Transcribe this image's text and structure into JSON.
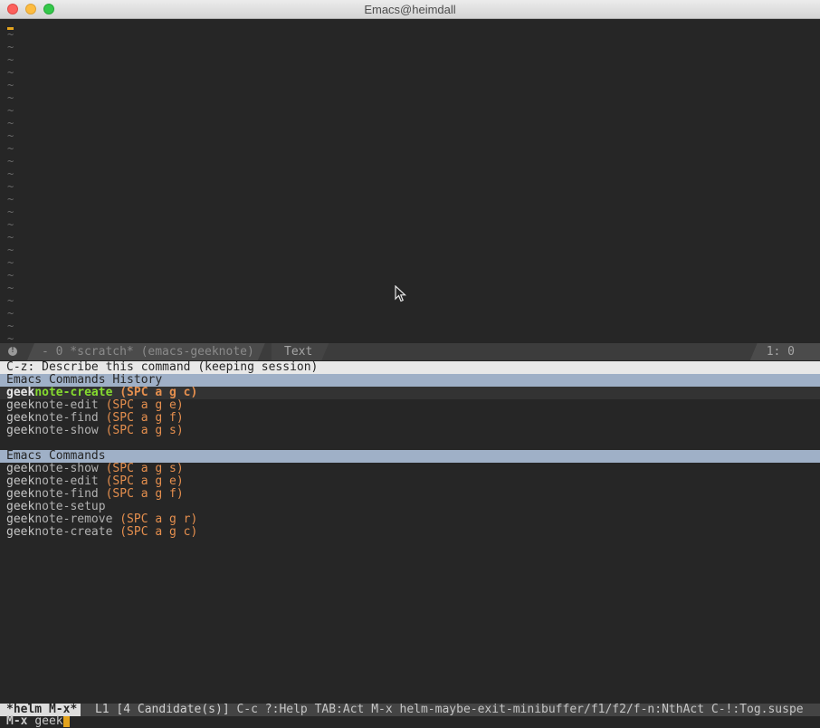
{
  "window": {
    "title": "Emacs@heimdall"
  },
  "buffer": {
    "empty_line_marker": "~",
    "empty_line_count": 25
  },
  "modeline": {
    "info_glyph": "!",
    "buffer_segment": "- 0 *scratch* (emacs-geeknote)",
    "major_mode": "Text",
    "position": "1: 0"
  },
  "helm": {
    "help_line": "C-z: Describe this command (keeping session)",
    "sources": [
      {
        "header": "Emacs Commands History",
        "candidates": [
          {
            "match": "geek",
            "rest": "note-create",
            "key": "(SPC a g c)",
            "selected": true
          },
          {
            "match": "geek",
            "rest": "note-edit",
            "key": "(SPC a g e)"
          },
          {
            "match": "geek",
            "rest": "note-find",
            "key": "(SPC a g f)"
          },
          {
            "match": "geek",
            "rest": "note-show",
            "key": "(SPC a g s)"
          }
        ]
      },
      {
        "header": "Emacs Commands",
        "candidates": [
          {
            "match": "geek",
            "rest": "note-show",
            "key": "(SPC a g s)"
          },
          {
            "match": "geek",
            "rest": "note-edit",
            "key": "(SPC a g e)"
          },
          {
            "match": "geek",
            "rest": "note-find",
            "key": "(SPC a g f)"
          },
          {
            "match": "geek",
            "rest": "note-setup",
            "key": ""
          },
          {
            "match": "geek",
            "rest": "note-remove",
            "key": "(SPC a g r)"
          },
          {
            "match": "geek",
            "rest": "note-create",
            "key": "(SPC a g c)"
          }
        ]
      }
    ]
  },
  "helm_modeline": {
    "name": "*helm M-x*",
    "line": "L1",
    "candidates": "[4 Candidate(s)]",
    "help": "C-c ?:Help TAB:Act M-x helm-maybe-exit-minibuffer/f1/f2/f-n:NthAct C-!:Tog.suspe"
  },
  "minibuffer": {
    "prompt": "M-x",
    "input": "geek"
  }
}
